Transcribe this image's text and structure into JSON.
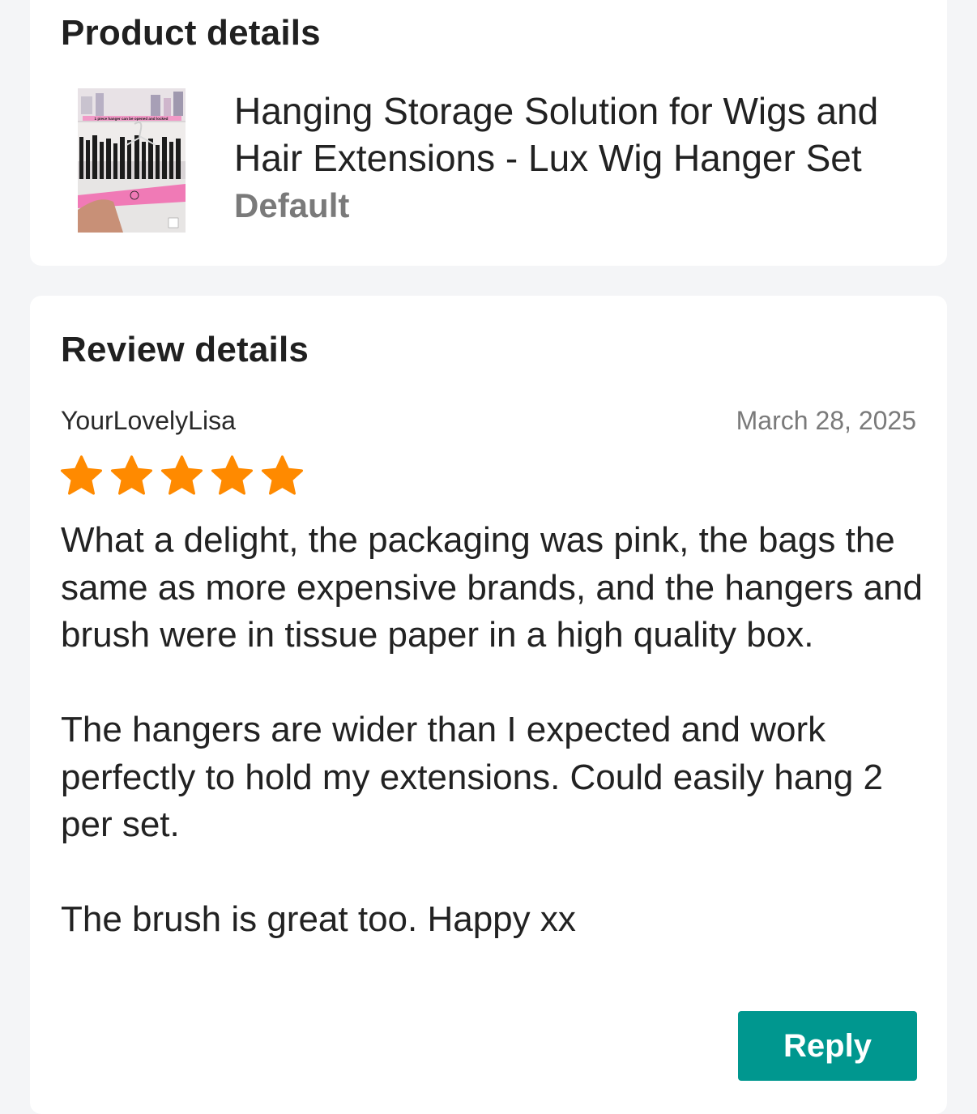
{
  "product_section": {
    "title": "Product details",
    "product_name": "Hanging Storage Solution for Wigs and Hair Extensions - Lux Wig Hanger Set",
    "variant": "Default",
    "thumbnail_banner_text": "1 piece hanger can be opened and locked"
  },
  "review_section": {
    "title": "Review details",
    "reviewer": "YourLovelyLisa",
    "date": "March 28, 2025",
    "rating": 5,
    "rating_max": 5,
    "star_color": "#ff8a00",
    "paragraphs": [
      "What a delight, the packaging was pink, the bags the same as more expensive brands, and the hangers and brush were in tissue paper in a high quality box.",
      "The hangers are wider than I expected and work perfectly to hold my extensions. Could easily hang 2 per set.",
      "The brush is great too. Happy xx"
    ],
    "reply_label": "Reply",
    "reply_color": "#00978f"
  }
}
